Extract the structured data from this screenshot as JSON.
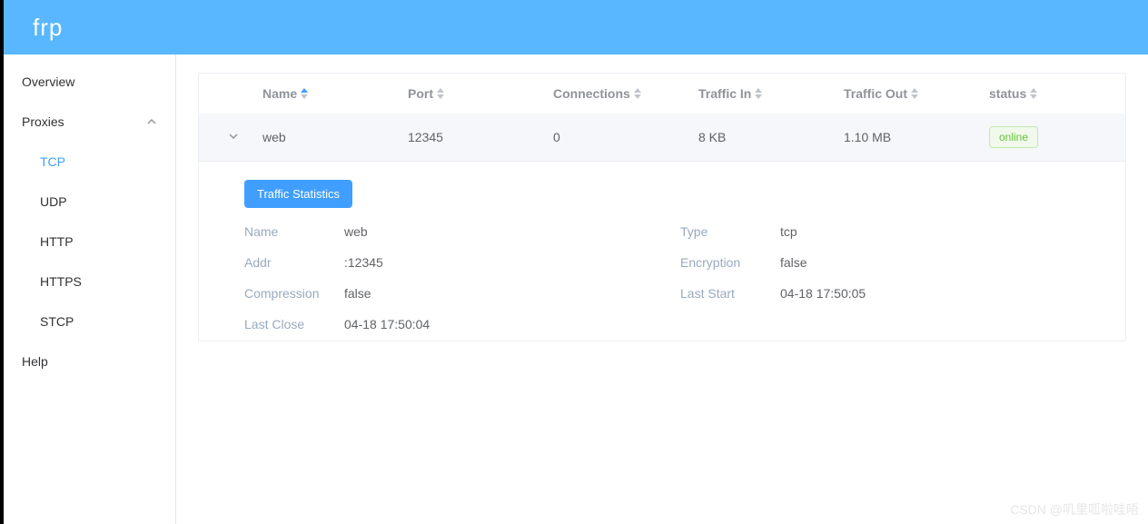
{
  "brand": "frp",
  "sidebar": {
    "overview": "Overview",
    "proxies": "Proxies",
    "items": [
      "TCP",
      "UDP",
      "HTTP",
      "HTTPS",
      "STCP"
    ],
    "help": "Help"
  },
  "columns": {
    "name": "Name",
    "port": "Port",
    "connections": "Connections",
    "traffic_in": "Traffic In",
    "traffic_out": "Traffic Out",
    "status": "status"
  },
  "rows": [
    {
      "name": "web",
      "port": "12345",
      "connections": "0",
      "traffic_in": "8 KB",
      "traffic_out": "1.10 MB",
      "status": "online"
    }
  ],
  "detail": {
    "button": "Traffic Statistics",
    "labels": {
      "name": "Name",
      "type": "Type",
      "addr": "Addr",
      "encryption": "Encryption",
      "compression": "Compression",
      "last_start": "Last Start",
      "last_close": "Last Close"
    },
    "values": {
      "name": "web",
      "type": "tcp",
      "addr": ":12345",
      "encryption": "false",
      "compression": "false",
      "last_start": "04-18 17:50:05",
      "last_close": "04-18 17:50:04"
    }
  },
  "watermark": "CSDN @叽里呱啦哇唔"
}
